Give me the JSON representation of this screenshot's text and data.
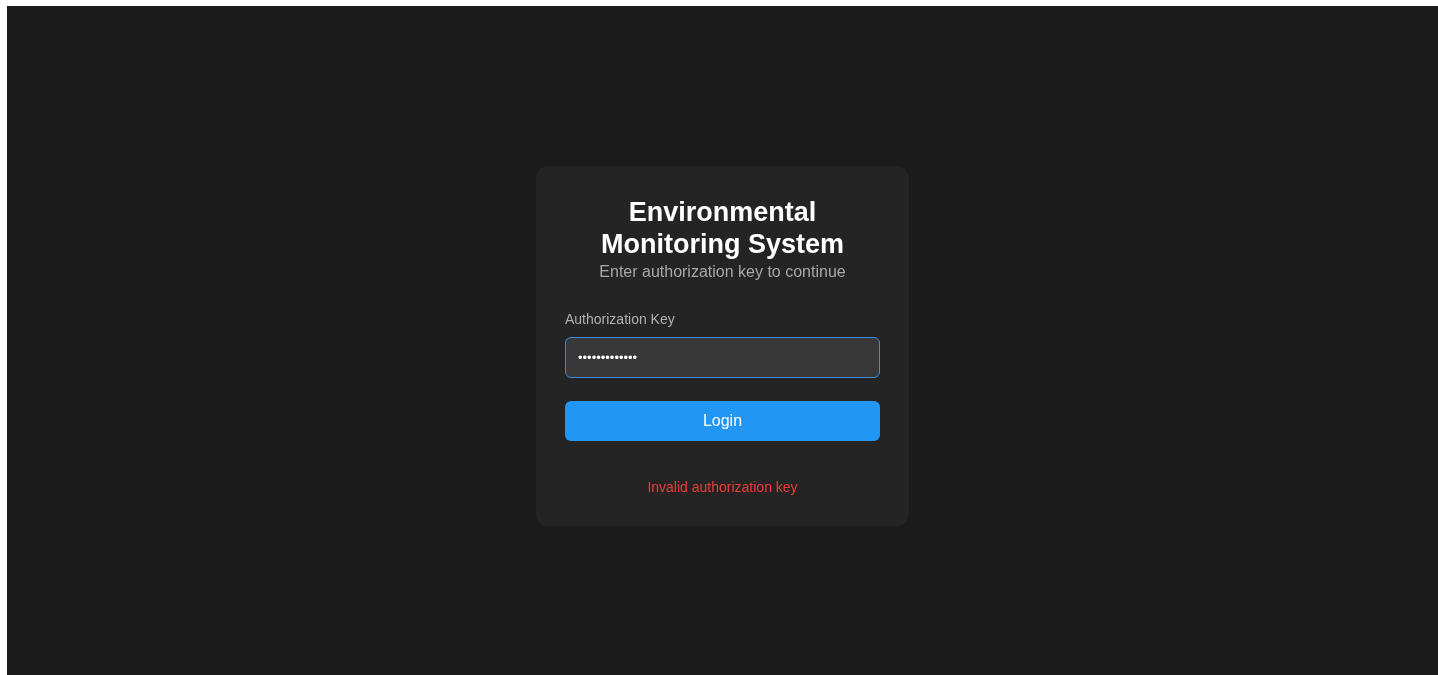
{
  "login": {
    "title": "Environmental Monitoring System",
    "subtitle": "Enter authorization key to continue",
    "field": {
      "label": "Authorization Key",
      "value": "•••••••••••••",
      "focused": true
    },
    "button": "Login",
    "error": "Invalid authorization key"
  }
}
